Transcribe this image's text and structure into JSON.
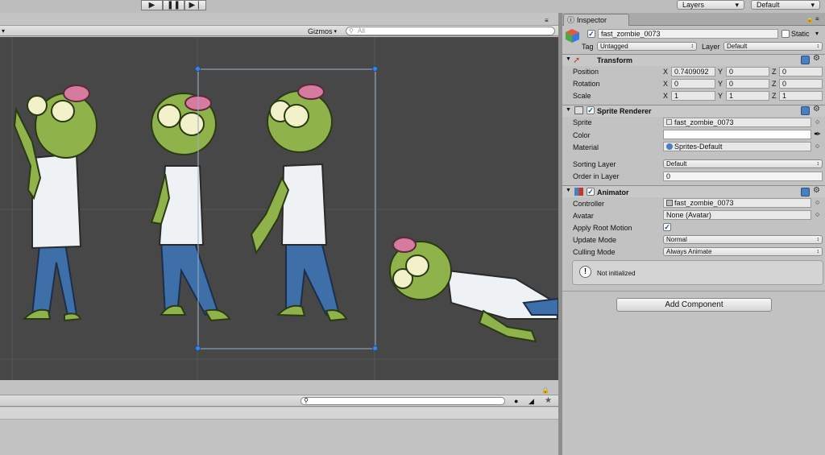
{
  "toolbar": {
    "layers": "Layers",
    "layout": "Default"
  },
  "scene": {
    "gizmos": "Gizmos",
    "search_placeholder": "All"
  },
  "inspector": {
    "tab": "Inspector",
    "object_name": "fast_zombie_0073",
    "static_label": "Static",
    "tag_label": "Tag",
    "tag_value": "Untagged",
    "layer_label": "Layer",
    "layer_value": "Default",
    "transform": {
      "title": "Transform",
      "rows": [
        {
          "label": "Position",
          "x": "0.7409092",
          "y": "0",
          "z": "0"
        },
        {
          "label": "Rotation",
          "x": "0",
          "y": "0",
          "z": "0"
        },
        {
          "label": "Scale",
          "x": "1",
          "y": "1",
          "z": "1"
        }
      ],
      "axis": {
        "x": "X",
        "y": "Y",
        "z": "Z"
      }
    },
    "sprite_renderer": {
      "title": "Sprite Renderer",
      "sprite_label": "Sprite",
      "sprite_value": "fast_zombie_0073",
      "color_label": "Color",
      "material_label": "Material",
      "material_value": "Sprites-Default",
      "sorting_label": "Sorting Layer",
      "sorting_value": "Default",
      "order_label": "Order in Layer",
      "order_value": "0"
    },
    "animator": {
      "title": "Animator",
      "controller_label": "Controller",
      "controller_value": "fast_zombie_0073",
      "avatar_label": "Avatar",
      "avatar_value": "None (Avatar)",
      "root_motion_label": "Apply Root Motion",
      "update_label": "Update Mode",
      "update_value": "Normal",
      "culling_label": "Culling Mode",
      "culling_value": "Always Animate",
      "status": "Not initialized"
    },
    "add_component": "Add Component"
  },
  "colors": {
    "scene_bg": "#474747",
    "zombie_skin": "#8fb24a",
    "shirt": "#eef2f4",
    "jeans": "#3f6fa8",
    "brain": "#d77aa0"
  }
}
